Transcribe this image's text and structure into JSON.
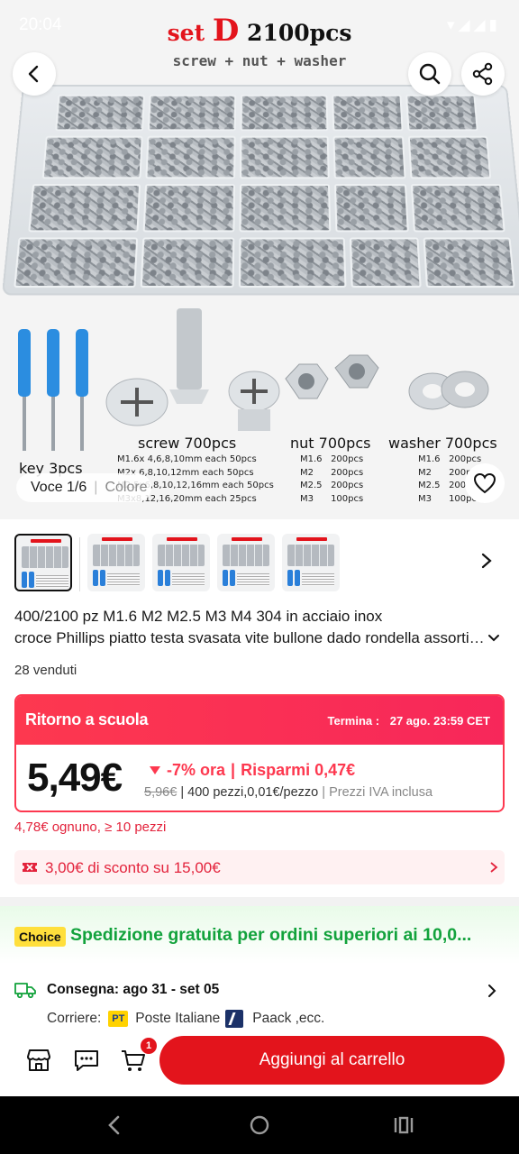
{
  "status_bar": {
    "time": "20:04"
  },
  "hero": {
    "promo_set_word": "set",
    "promo_set_letter": "D",
    "promo_pcs": "2100pcs",
    "promo_subtitle": "screw + nut + washer",
    "screwdriver_label": "key 3pcs",
    "screw_label": "screw 700pcs",
    "nut_label": "nut 700pcs",
    "washer_label": "washer 700pcs",
    "screw_specs": "M1.6x 4,6,8,10mm each 50pcs\nM2x 6,8,10,12mm each 50pcs\nM2.5x6,8,10,12,16mm each 50pcs\nM3x8,12,16,20mm each 25pcs",
    "nut_specs": "M1.6   200pcs\nM2      200pcs\nM2.5   200pcs\nM3      100pcs",
    "washer_specs": "M1.6   200pcs\nM2      200pcs\nM2.5   200pcs\nM3      100pcs",
    "variant_counter": "Voce 1/6",
    "variant_color_label": "Colore"
  },
  "product": {
    "title_line1": "400/2100 pz M1.6 M2 M2.5 M3 M4 304 in acciaio inox",
    "title_line2": "croce Phillips piatto testa svasata vite bullone dado rondella assortimento",
    "sold": "28 venduti"
  },
  "deal": {
    "name": "Ritorno a scuola",
    "ends_label": "Termina :",
    "ends_value": "27 ago. 23:59 CET",
    "price": "5,49€",
    "discount": "-7% ora",
    "savings": "Risparmi 0,47€",
    "old_price": "5,96€",
    "unit_info": "400 pezzi,0,01€/pezzo",
    "vat_note": "Prezzi IVA inclusa",
    "bulk_price": "4,78€ ognuno, ≥ 10 pezzi",
    "coupon": "3,00€ di sconto su 15,00€"
  },
  "shipping": {
    "choice_badge": "Choice",
    "choice_text": "Spedizione gratuita per ordini superiori ai 10,0...",
    "delivery_label": "Consegna:",
    "delivery_dates": "ago 31 - set 05",
    "carriers_label": "Corriere:",
    "carrier_pt_logo": "PT",
    "carrier_1": "Poste Italiane",
    "carrier_2": "Paack ,ecc."
  },
  "actions": {
    "cart_count": "1",
    "add_to_cart": "Aggiungi al carrello"
  },
  "colors": {
    "accent": "#e3141c",
    "deal": "#fd384f",
    "choice_green": "#12a23c",
    "choice_badge": "#ffdf3c"
  }
}
